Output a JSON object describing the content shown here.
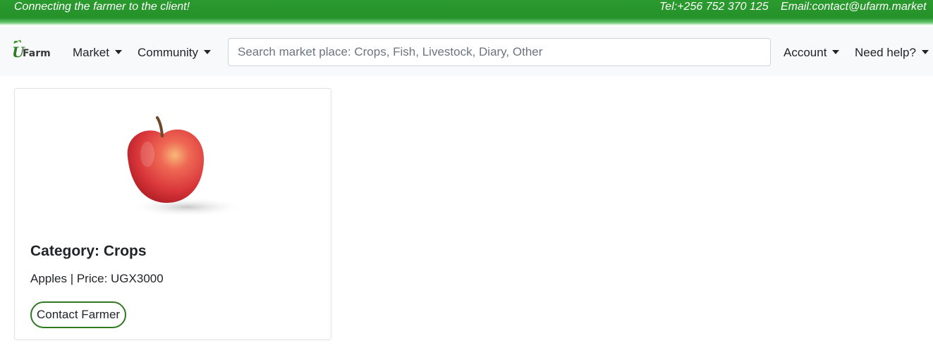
{
  "topbar": {
    "tagline": "Connecting the farmer to the client!",
    "phone": "Tel:+256 752 370 125",
    "email": "Email:contact@ufarm.market",
    "color": "#25922a"
  },
  "navbar": {
    "logo_text": "UFarm",
    "items": [
      {
        "label": "Market"
      },
      {
        "label": "Community"
      },
      {
        "label": "Account"
      },
      {
        "label": "Need help?"
      }
    ],
    "search": {
      "placeholder": "Search market place: Crops, Fish, Livestock, Diary, Other",
      "value": ""
    }
  },
  "products": [
    {
      "image_icon": "apple-image",
      "category_label": "Category: Crops",
      "details": "Apples | Price: UGX3000",
      "button_label": "Contact Farmer",
      "button_color": "#2d7a1f"
    }
  ]
}
